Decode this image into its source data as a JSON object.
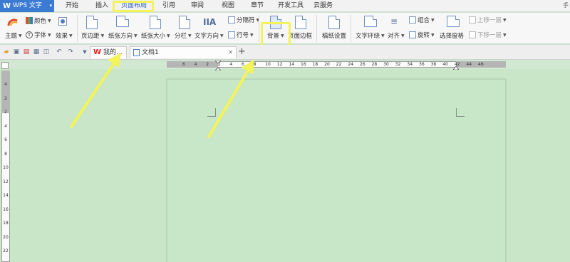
{
  "app": {
    "title": "WPS 文字"
  },
  "menu": {
    "tabs": [
      "开始",
      "插入",
      "页面布局",
      "引用",
      "审阅",
      "视图",
      "章节",
      "开发工具",
      "云服务"
    ],
    "active": "页面布局",
    "right_stub": "手"
  },
  "ribbon": {
    "theme": "主题",
    "colors": "颜色",
    "fonts": "字体",
    "effects": "效果",
    "margins": "页边距",
    "orientation": "纸张方向",
    "size": "纸张大小",
    "columns": "分栏",
    "text_direction": "文字方向",
    "breaks": "分隔符",
    "line_numbers": "行号",
    "background": "背景",
    "page_border": "页面边框",
    "page_setup": "稿纸设置",
    "text_wrap": "文字环绕",
    "align": "对齐",
    "group": "组合",
    "rotate": "旋转",
    "selection_pane": "选择窗格",
    "bring_forward": "上移一层",
    "send_backward": "下移一层"
  },
  "doc_tabs": [
    {
      "label": "我的..."
    },
    {
      "label": "文档1"
    }
  ],
  "ruler": {
    "h_ticks": [
      "6",
      "4",
      "2",
      "2",
      "4",
      "6",
      "8",
      "10",
      "12",
      "14",
      "16",
      "18",
      "20",
      "22",
      "24",
      "26",
      "28",
      "30",
      "32",
      "34",
      "36",
      "38",
      "40",
      "42",
      "44",
      "46"
    ],
    "v_ticks": [
      "4",
      "2",
      "2",
      "4",
      "6",
      "8",
      "10",
      "12",
      "14",
      "16",
      "18",
      "20",
      "22"
    ]
  },
  "colors": {
    "menu_accent": "#2a62c4",
    "wps_blue": "#3c7bd4",
    "highlight_yellow": "#f3f35a",
    "page_green": "#c8e6c8"
  }
}
